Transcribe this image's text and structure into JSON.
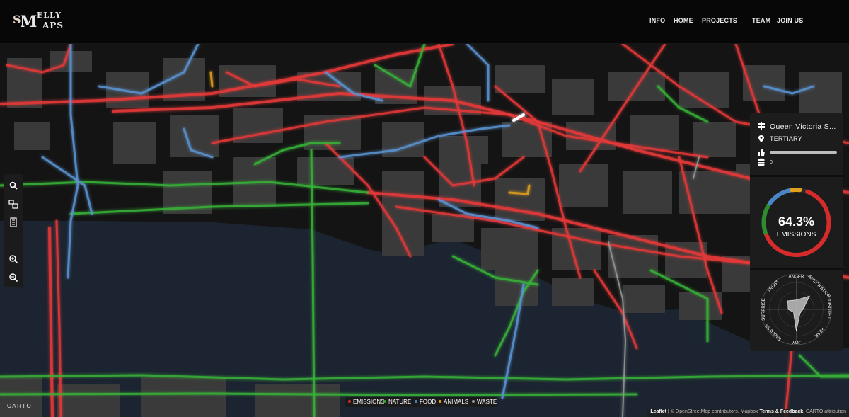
{
  "header": {
    "logo": {
      "l1": "S",
      "l2": "M",
      "l3": "ELLY",
      "l4": "APS"
    },
    "nav": [
      "INFO",
      "HOME",
      "PROJECTS",
      "TEAM",
      "JOIN US"
    ]
  },
  "toolbar": {
    "tools": [
      "search-icon",
      "select-area-icon",
      "layers-icon",
      "zoom-in-icon",
      "zoom-out-icon"
    ]
  },
  "panel": {
    "street_name": "Queen Victoria S...",
    "road_type": "TERTIARY",
    "likes_fraction": 1.0,
    "count": "0",
    "emissions": {
      "percent": "64.3%",
      "label": "EMISSIONS",
      "ring_segments": [
        {
          "category": "emissions",
          "color": "#d52b2b",
          "fraction": 0.643
        },
        {
          "category": "nature",
          "color": "#2e8b2e",
          "fraction": 0.15
        },
        {
          "category": "food",
          "color": "#4a86c5",
          "fraction": 0.13
        },
        {
          "category": "animals",
          "color": "#e0a020",
          "fraction": 0.05
        }
      ]
    },
    "emotions": {
      "labels": [
        "ANGER",
        "ANTICIPATION",
        "DISGUST",
        "FEAR",
        "JOY",
        "SADNESS",
        "SURPRISE",
        "TRUST"
      ],
      "values": [
        0.35,
        0.7,
        0.25,
        0.2,
        0.8,
        0.15,
        0.3,
        0.45
      ]
    }
  },
  "legend": [
    {
      "label": "EMISSIONS",
      "color": "#e02525"
    },
    {
      "label": "NATURE",
      "color": "#2ea02e"
    },
    {
      "label": "FOOD",
      "color": "#4a86c5"
    },
    {
      "label": "ANIMALS",
      "color": "#e0a020"
    },
    {
      "label": "WASTE",
      "color": "#9a9a9a"
    }
  ],
  "map": {
    "carto_logo": "CARTO",
    "attribution_leaflet": "Leaflet",
    "attribution_rest": " | © OpenStreetMap contributors, Mapbox ",
    "attribution_terms": "Terms & Feedback",
    "attribution_carto": ", CARTO attribution",
    "colors": {
      "emissions": "#e53838",
      "nature": "#37b237",
      "food": "#5b93d1",
      "animals": "#e0a020",
      "waste": "#999999",
      "water": "#1b2430",
      "building": "#3a3a3a"
    }
  }
}
